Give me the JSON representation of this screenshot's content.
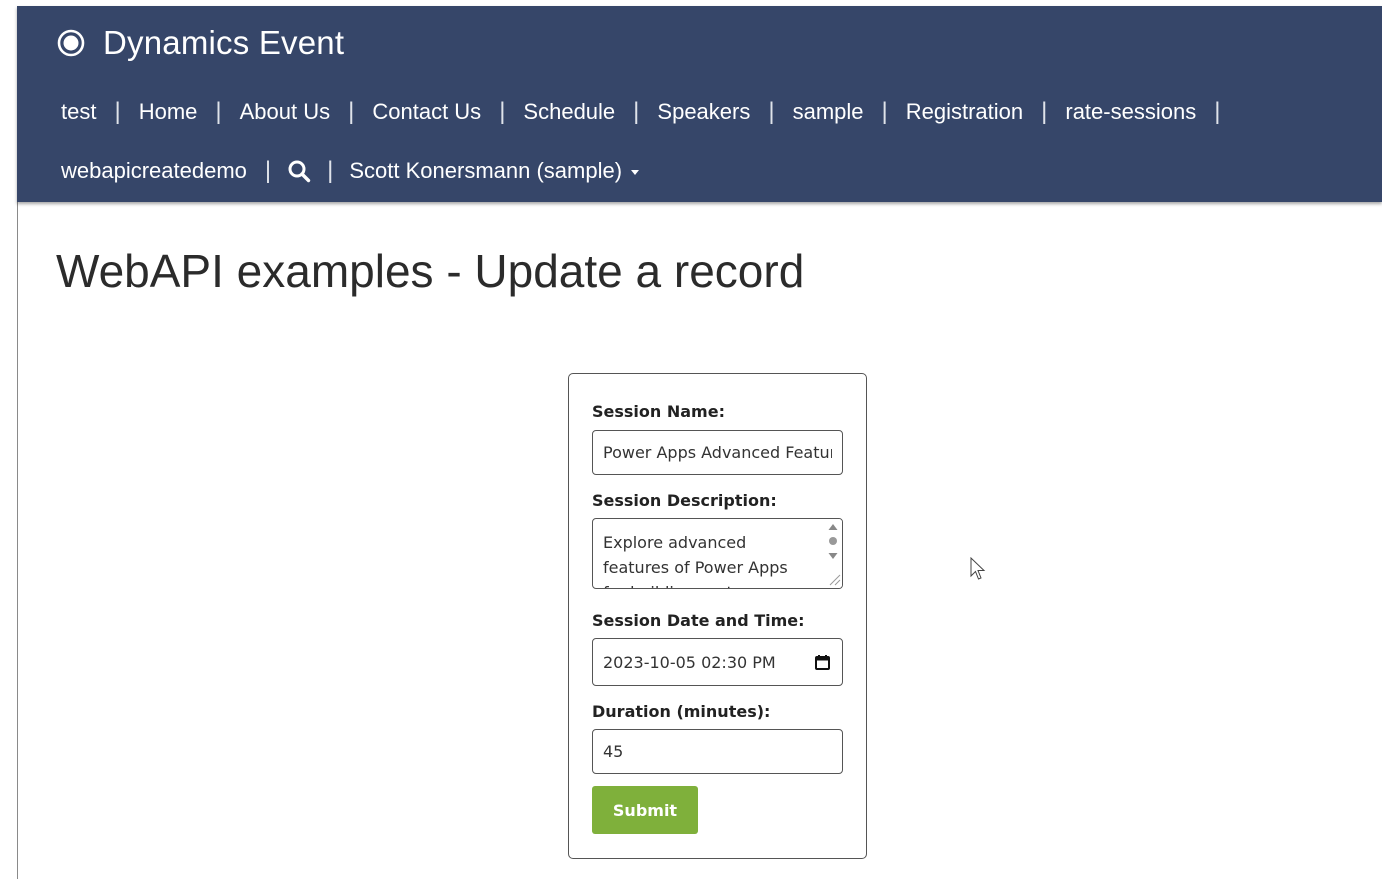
{
  "brand": {
    "title": "Dynamics Event",
    "icon": "portal-logo-icon"
  },
  "nav": {
    "row1": [
      "test",
      "Home",
      "About Us",
      "Contact Us",
      "Schedule",
      "Speakers",
      "sample",
      "Registration",
      "rate-sessions"
    ],
    "row2_link": "webapicreatedemo",
    "search_icon": "search-icon",
    "user_menu": "Scott Konersmann (sample)"
  },
  "page": {
    "title": "WebAPI examples - Update a record"
  },
  "form": {
    "session_name_label": "Session Name:",
    "session_name_value": "Power Apps Advanced Features",
    "session_description_label": "Session Description:",
    "session_description_value": "Explore advanced features of Power Apps for building custom solutions",
    "session_datetime_label": "Session Date and Time:",
    "session_datetime_value": "2023-10-05 02:30 PM",
    "duration_label": "Duration (minutes):",
    "duration_value": "45",
    "submit_label": "Submit"
  },
  "colors": {
    "navbar": "#364669",
    "submit": "#7fb03b"
  }
}
